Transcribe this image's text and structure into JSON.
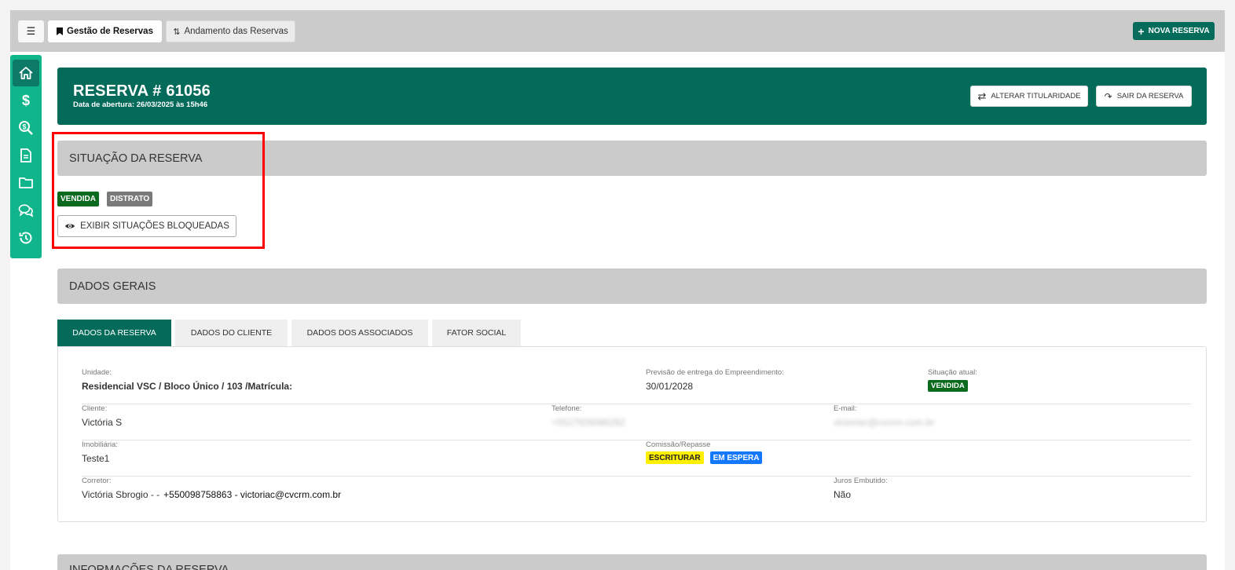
{
  "topbar": {
    "menu_icon": "hamburger-icon",
    "tab_gestao": "Gestão de Reservas",
    "tab_andamento": "Andamento das Reservas",
    "new_button": "NOVA RESERVA"
  },
  "sidebar": {
    "items": [
      {
        "icon": "home-icon"
      },
      {
        "icon": "dollar-icon"
      },
      {
        "icon": "search-dollar-icon"
      },
      {
        "icon": "document-icon"
      },
      {
        "icon": "folder-icon"
      },
      {
        "icon": "comments-icon"
      },
      {
        "icon": "history-icon"
      }
    ]
  },
  "banner": {
    "title": "RESERVA # 61056",
    "subtitle": "Data de abertura: 26/03/2025 às 15h46",
    "btn_alterar": "ALTERAR TITULARIDADE",
    "btn_sair": "SAIR DA RESERVA"
  },
  "situacao": {
    "header": "SITUAÇÃO DA RESERVA",
    "badge_vendida": "VENDIDA",
    "badge_distrato": "DISTRATO",
    "exibir_btn": "EXIBIR SITUAÇÕES BLOQUEADAS"
  },
  "dados_gerais": {
    "header": "DADOS GERAIS",
    "tabs": [
      "DADOS DA RESERVA",
      "DADOS DO CLIENTE",
      "DADOS DOS ASSOCIADOS",
      "FATOR SOCIAL"
    ],
    "unidade_label": "Unidade:",
    "unidade_value": "Residencial VSC / Bloco Único / 103 /Matrícula:",
    "previsao_label": "Previsão de entrega do Empreendimento:",
    "previsao_value": "30/01/2028",
    "situacao_label": "Situação atual:",
    "situacao_value": "VENDIDA",
    "cliente_label": "Cliente:",
    "cliente_value": "Victória S",
    "telefone_label": "Telefone:",
    "telefone_value": "+5527926086282",
    "email_label": "E-mail:",
    "email_value": "victoriac@cvcrm.com.br",
    "imobiliaria_label": "Imobiliária:",
    "imobiliaria_value": "Teste1",
    "comissao_label": "Comissão/Repasse",
    "comissao_badge1": "ESCRITURAR",
    "comissao_badge2": "EM ESPERA",
    "corretor_label": "Corretor:",
    "corretor_name": "Victória Sbrogio - -",
    "corretor_contact": "+550098758863 - victoriac@cvcrm.com.br",
    "juros_label": "Juros Embutido:",
    "juros_value": "Não"
  },
  "next_section": {
    "header": "INFORMAÇÕES DA RESERVA"
  },
  "colors": {
    "primary": "#046b5b",
    "sidebar": "#10b58c",
    "highlight": "#ff0000"
  }
}
